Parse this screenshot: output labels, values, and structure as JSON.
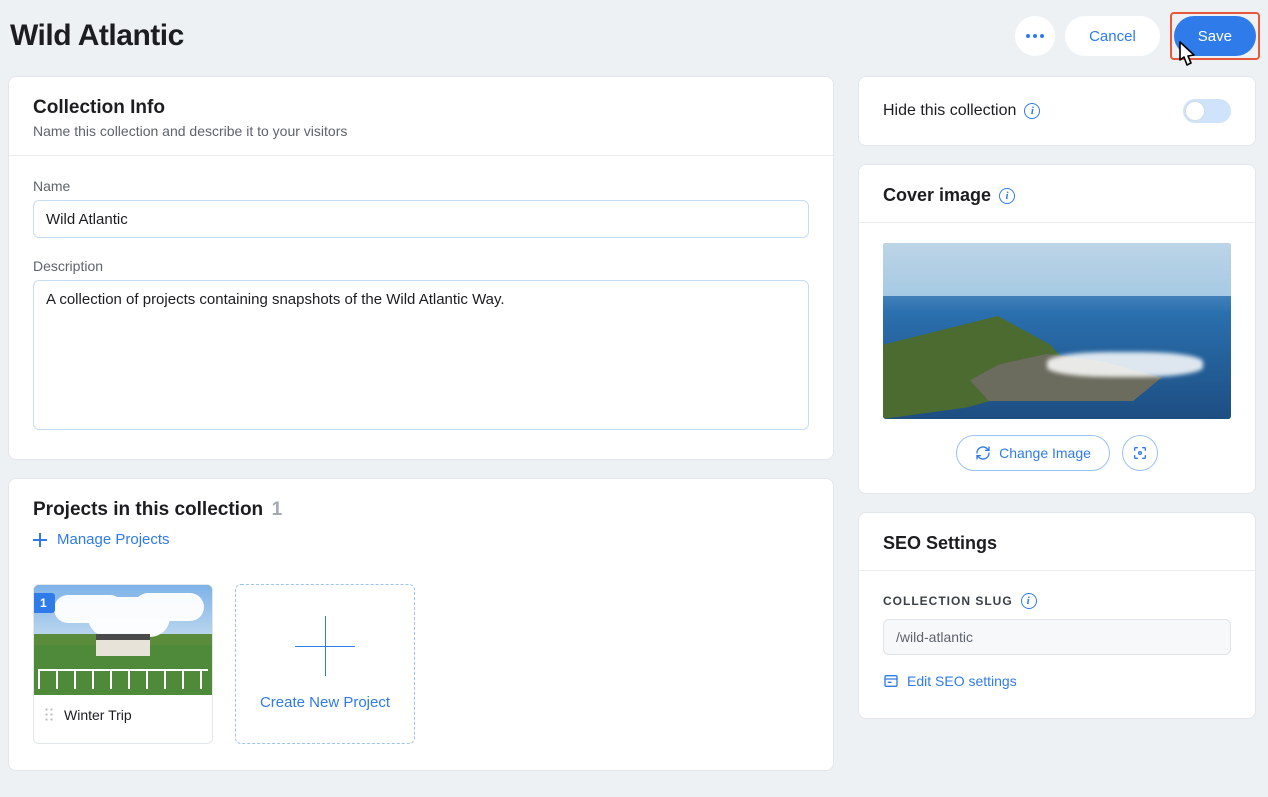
{
  "header": {
    "title": "Wild Atlantic",
    "cancel_label": "Cancel",
    "save_label": "Save"
  },
  "collection_info": {
    "title": "Collection Info",
    "subtitle": "Name this collection and describe it to your visitors",
    "name_label": "Name",
    "name_value": "Wild Atlantic",
    "description_label": "Description",
    "description_value": "A collection of projects containing snapshots of the Wild Atlantic Way."
  },
  "projects": {
    "title": "Projects in this collection",
    "count": "1",
    "manage_label": "Manage Projects",
    "items": [
      {
        "badge": "1",
        "name": "Winter Trip"
      }
    ],
    "create_label": "Create New Project"
  },
  "hide": {
    "label": "Hide this collection",
    "enabled": false
  },
  "cover": {
    "title": "Cover image",
    "change_label": "Change Image"
  },
  "seo": {
    "title": "SEO Settings",
    "slug_label": "COLLECTION SLUG",
    "slug_value": "/wild-atlantic",
    "edit_label": "Edit SEO settings"
  }
}
